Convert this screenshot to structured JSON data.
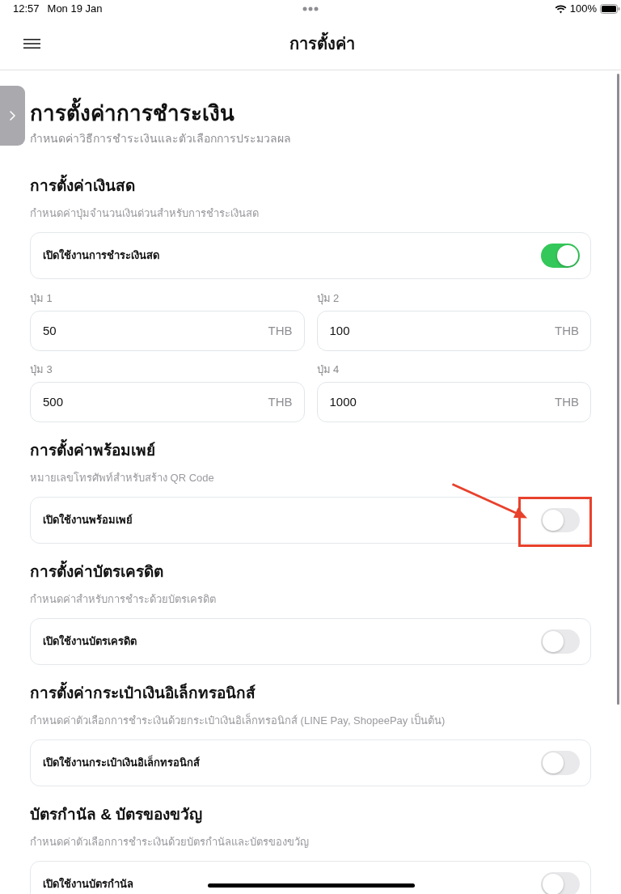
{
  "status_bar": {
    "time": "12:57",
    "date": "Mon 19 Jan",
    "battery": "100%"
  },
  "nav_bar": {
    "title": "การตั้งค่า"
  },
  "page": {
    "title": "การตั้งค่าการชำระเงิน",
    "subtitle": "กำหนดค่าวิธีการชำระเงินและตัวเลือกการประมวลผล"
  },
  "sections": [
    {
      "heading": "การตั้งค่าเงินสด",
      "description": "กำหนดค่าปุ่มจำนวนเงินด่วนสำหรับการชำระเงินสด",
      "toggle": {
        "label": "เปิดใช้งานการชำระเงินสด",
        "on": true,
        "highlighted": false
      },
      "amount_fields": [
        {
          "label": "ปุ่ม 1",
          "value": "50",
          "unit": "THB"
        },
        {
          "label": "ปุ่ม 2",
          "value": "100",
          "unit": "THB"
        },
        {
          "label": "ปุ่ม 3",
          "value": "500",
          "unit": "THB"
        },
        {
          "label": "ปุ่ม 4",
          "value": "1000",
          "unit": "THB"
        }
      ]
    },
    {
      "heading": "การตั้งค่าพร้อมเพย์",
      "description": "หมายเลขโทรศัพท์สำหรับสร้าง QR Code",
      "toggle": {
        "label": "เปิดใช้งานพร้อมเพย์",
        "on": false,
        "highlighted": true
      }
    },
    {
      "heading": "การตั้งค่าบัตรเครดิต",
      "description": "กำหนดค่าสำหรับการชำระด้วยบัตรเครดิต",
      "toggle": {
        "label": "เปิดใช้งานบัตรเครดิต",
        "on": false,
        "highlighted": false
      }
    },
    {
      "heading": "การตั้งค่ากระเป๋าเงินอิเล็กทรอนิกส์",
      "description": "กำหนดค่าตัวเลือกการชำระเงินด้วยกระเป๋าเงินอิเล็กทรอนิกส์ (LINE Pay, ShopeePay เป็นต้น)",
      "toggle": {
        "label": "เปิดใช้งานกระเป๋าเงินอิเล็กทรอนิกส์",
        "on": false,
        "highlighted": false
      }
    },
    {
      "heading": "บัตรกำนัล & บัตรของขวัญ",
      "description": "กำหนดค่าตัวเลือกการชำระเงินด้วยบัตรกำนัลและบัตรของขวัญ",
      "toggle": {
        "label": "เปิดใช้งานบัตรกำนัล",
        "on": false,
        "highlighted": false
      }
    }
  ]
}
